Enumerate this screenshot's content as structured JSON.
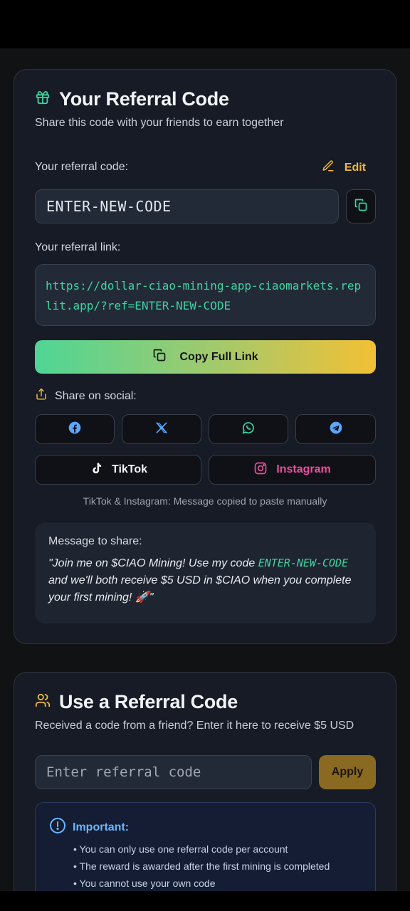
{
  "referral_card": {
    "title": "Your Referral Code",
    "subtitle": "Share this code with your friends to earn together",
    "code_label": "Your referral code:",
    "edit_label": "Edit",
    "code_value": "ENTER-NEW-CODE",
    "link_label": "Your referral link:",
    "link_value": "https://dollar-ciao-mining-app-ciaomarkets.replit.app/?ref=ENTER-NEW-CODE",
    "copy_full_label": "Copy Full Link",
    "share_label": "Share on social:",
    "social": {
      "facebook_icon": "facebook-icon",
      "x_icon": "x-icon",
      "whatsapp_icon": "whatsapp-icon",
      "telegram_icon": "telegram-icon",
      "tiktok_label": "TikTok",
      "instagram_label": "Instagram"
    },
    "social_note": "TikTok & Instagram: Message copied to paste manually",
    "message_title": "Message to share:",
    "message_part1": "\"Join me on $CIAO Mining! Use my code ",
    "message_code": "ENTER-NEW-CODE",
    "message_part2": " and we'll both receive $5 USD in $CIAO when you complete your first mining! 🚀\""
  },
  "use_code_card": {
    "title": "Use a Referral Code",
    "subtitle": "Received a code from a friend? Enter it here to receive $5 USD",
    "input_placeholder": "Enter referral code",
    "apply_label": "Apply",
    "important_title": "Important:",
    "important_items": [
      "• You can only use one referral code per account",
      "• The reward is awarded after the first mining is completed",
      "• You cannot use your own code"
    ]
  },
  "colors": {
    "accent_green": "#3dd4a0",
    "accent_yellow": "#f0b83a",
    "instagram_pink": "#ec4d9e",
    "info_blue": "#67b6ff"
  }
}
